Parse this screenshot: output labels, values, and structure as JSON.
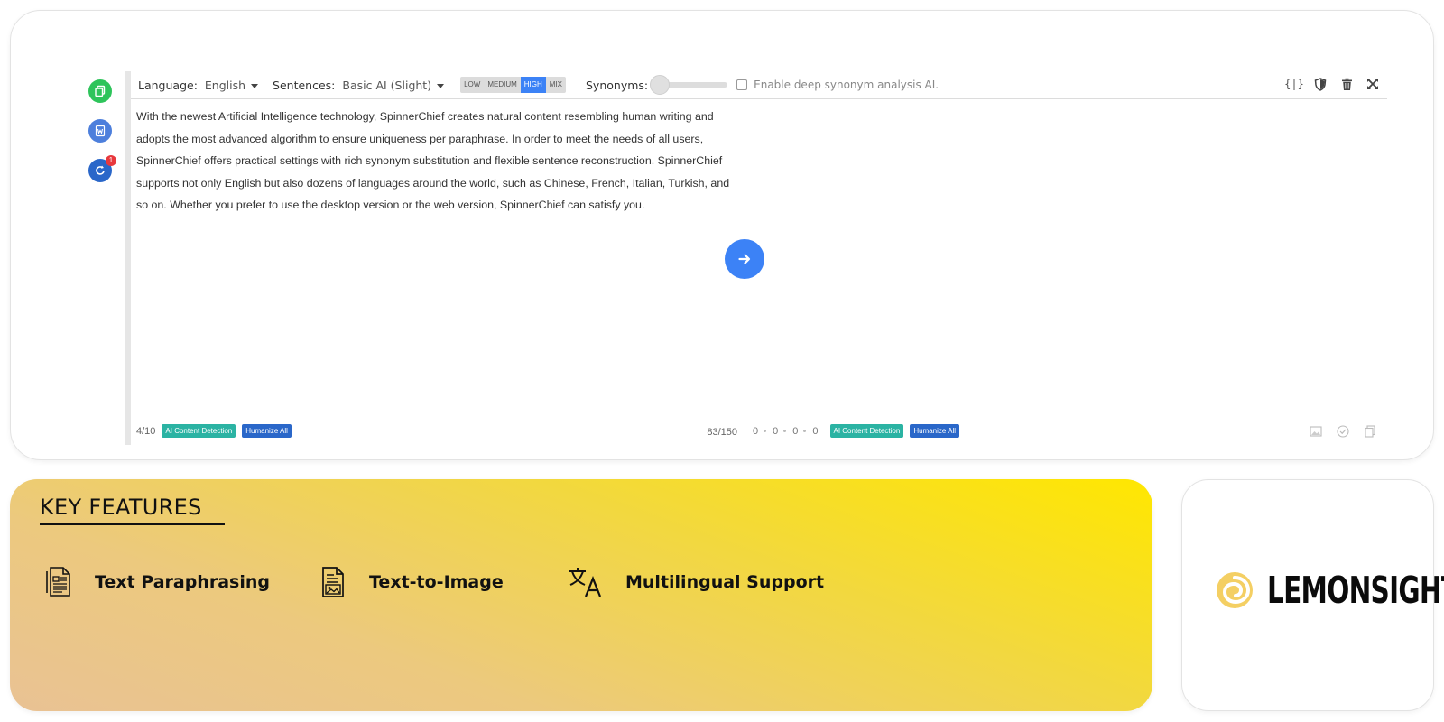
{
  "toolbar": {
    "language_label": "Language:",
    "language_value": "English",
    "sentences_label": "Sentences:",
    "sentences_value": "Basic AI (Slight)",
    "levels": [
      "LOW",
      "MEDIUM",
      "HIGH",
      "MIX"
    ],
    "active_level": "HIGH",
    "synonyms_label": "Synonyms:",
    "synonyms_level": 0,
    "deep_synonym_label": "Enable deep synonym analysis AI.",
    "deep_synonym_checked": false,
    "json_icon": "{|}"
  },
  "side_buttons": [
    {
      "icon": "copy-icon",
      "color": "#2ec45b"
    },
    {
      "icon": "word-document-icon",
      "color": "#4d7fdc"
    },
    {
      "icon": "refresh-icon",
      "color": "#2a67c9",
      "badge": "1"
    }
  ],
  "input": {
    "text": "With the newest Artificial Intelligence technology, SpinnerChief creates natural content resembling human writing and adopts the most advanced algorithm to ensure uniqueness per paraphrase. In order to meet the needs of all users, SpinnerChief offers practical settings with rich synonym substitution and flexible sentence reconstruction. SpinnerChief supports not only English but also dozens of languages around the world, such as Chinese, French, Italian, Turkish, and so on. Whether you prefer to use the desktop version or the web version, SpinnerChief can satisfy you.",
    "sentence_count": "4/10",
    "word_count": "83/150",
    "ai_detection_label": "AI Content Detection",
    "humanize_label": "Humanize All"
  },
  "output": {
    "stats": [
      "0",
      "0",
      "0",
      "0"
    ],
    "ai_detection_label": "AI Content Detection",
    "humanize_label": "Humanize All"
  },
  "features": {
    "title": "KEY FEATURES",
    "items": [
      {
        "label": "Text Paraphrasing",
        "icon": "document-text-icon"
      },
      {
        "label": "Text-to-Image",
        "icon": "document-image-icon"
      },
      {
        "label": "Multilingual Support",
        "icon": "translate-icon"
      }
    ]
  },
  "brand": {
    "name": "LEMONSIGHT"
  },
  "colors": {
    "accent": "#3c82f6",
    "teal": "#2bb3a3",
    "navy": "#2a67c9",
    "green": "#2ec45b",
    "yellow": "#ffe700"
  }
}
